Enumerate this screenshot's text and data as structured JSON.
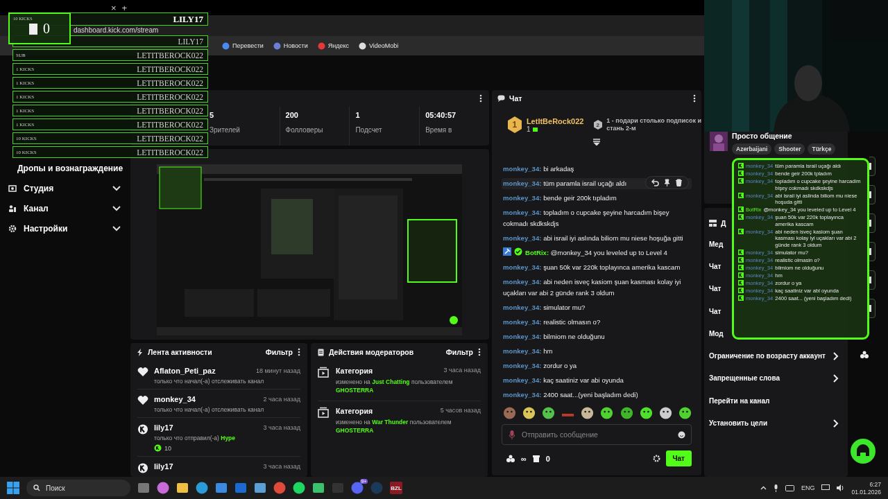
{
  "browser": {
    "tab_close": "×",
    "new_tab": "+",
    "address": "dashboard.kick.com/stream",
    "bookmarks": [
      "Перевести",
      "Новости",
      "Яндекс",
      "VideoMobi"
    ]
  },
  "sidebar": {
    "items": [
      {
        "label": "Дропы и вознаграждение",
        "kind": "subitem"
      },
      {
        "label": "Студия",
        "kind": "section"
      },
      {
        "label": "Канал",
        "kind": "section"
      },
      {
        "label": "Настройки",
        "kind": "section"
      }
    ]
  },
  "stats": [
    {
      "value": "5",
      "label": "Зрителей"
    },
    {
      "value": "200",
      "label": "Фолловеры"
    },
    {
      "value": "1",
      "label": "Подсчет"
    },
    {
      "value": "05:40:57",
      "label": "Время в"
    }
  ],
  "activity": {
    "title": "Лента активности",
    "filter": "Фильтр",
    "items": [
      {
        "kind": "follow",
        "user": "Aflaton_Peti_paz",
        "time": "18 минут назад",
        "text": "только что начал(-а) отслеживать канал"
      },
      {
        "kind": "follow",
        "user": "monkey_34",
        "time": "2 часа назад",
        "text": "только что начал(-а) отслеживать канал"
      },
      {
        "kind": "gift",
        "user": "lily17",
        "time": "3 часа назад",
        "text": "только что отправил(-а)",
        "highlight": "Hype",
        "amount": "10"
      },
      {
        "kind": "gift",
        "user": "lily17",
        "time": "3 часа назад"
      }
    ]
  },
  "mod_actions": {
    "title": "Действия модераторов",
    "filter": "Фильтр",
    "items": [
      {
        "title": "Категория",
        "time": "3 часа назад",
        "prefix": "изменено на",
        "target": "Just Chatting",
        "suffix": "пользователем",
        "user": "GHOSTERRA"
      },
      {
        "title": "Категория",
        "time": "5 часов назад",
        "prefix": "изменено на",
        "target": "War Thunder",
        "suffix": "пользователем",
        "user": "GHOSTERRA"
      }
    ]
  },
  "chat": {
    "title": "Чат",
    "leader": {
      "rank": "1",
      "user": "LetItBeRock022",
      "count": "1",
      "next_rank": "2",
      "next_text": "1 - подари столько подписок и стань 2-м"
    },
    "messages": [
      {
        "kind": "user",
        "user": "monkey_34:",
        "text": "bi arkadaş",
        "hovered": false
      },
      {
        "kind": "user",
        "user": "monkey_34:",
        "text": "tüm paramla israil uçağı aldı",
        "hovered": true
      },
      {
        "kind": "user",
        "user": "monkey_34:",
        "text": "bende geir 200k tıpladım",
        "hovered": false
      },
      {
        "kind": "user",
        "user": "monkey_34:",
        "text": "topladım o cupcake şeyine harcadım bişey cokmadı skdkskdjs",
        "hovered": false
      },
      {
        "kind": "user",
        "user": "monkey_34:",
        "text": "abi israil iyi aslında biliom mu niese hoşuğa gitti",
        "hovered": false
      },
      {
        "kind": "bot",
        "user": "BotRix:",
        "text": "@monkey_34 you leveled up to Level 4",
        "hovered": false
      },
      {
        "kind": "user",
        "user": "monkey_34:",
        "text": "şuan 50k var 220k toplayınca amerika kascam",
        "hovered": false
      },
      {
        "kind": "user",
        "user": "monkey_34:",
        "text": "abi neden isveç kasiom şuan kasması kolay iyi uçakları var abi 2 günde rank 3 oldum",
        "hovered": false
      },
      {
        "kind": "user",
        "user": "monkey_34:",
        "text": "simulator mu?",
        "hovered": false
      },
      {
        "kind": "user",
        "user": "monkey_34:",
        "text": "realistic olmasın o?",
        "hovered": false
      },
      {
        "kind": "user",
        "user": "monkey_34:",
        "text": "bilmiom ne olduğunu",
        "hovered": false
      },
      {
        "kind": "user",
        "user": "monkey_34:",
        "text": "hm",
        "hovered": false
      },
      {
        "kind": "user",
        "user": "monkey_34:",
        "text": "zordur o ya",
        "hovered": false
      },
      {
        "kind": "user",
        "user": "monkey_34:",
        "text": "kaç saatiniz var abi oyunda",
        "hovered": false
      },
      {
        "kind": "user",
        "user": "monkey_34:",
        "text": "2400 saat...(yeni başladım dedi)",
        "hovered": false
      }
    ],
    "input": {
      "placeholder": "Отправить сообщение"
    },
    "points": "∞",
    "store": "0",
    "send": "Чат"
  },
  "stream_info": {
    "title": "Просто общение",
    "tags": [
      "Azerbaijani",
      "Shooter",
      "Türkçe"
    ]
  },
  "channel_actions": {
    "title": "Д",
    "items": [
      {
        "label": "Мед",
        "arrow": false
      },
      {
        "label": "Чат",
        "arrow": false
      },
      {
        "label": "Чат",
        "arrow": false
      },
      {
        "label": "Чат",
        "arrow": false
      },
      {
        "label": "Мод",
        "arrow": false
      },
      {
        "label": "Ограничение по возрасту аккаунт",
        "arrow": true
      },
      {
        "label": "Запрещенные слова",
        "arrow": true
      },
      {
        "label": "Перейти на канал",
        "arrow": false
      },
      {
        "label": "Установить цели",
        "arrow": true
      }
    ]
  },
  "gift_overlay": {
    "box_label": "10 KICKS",
    "box_value": "0",
    "rows": [
      {
        "name": "LILY17",
        "top": true
      },
      {
        "name": "LILY17",
        "top": false
      },
      {
        "label": "SUB",
        "name": "LETITBEROCK022",
        "top": false
      },
      {
        "label": "1 KICKS",
        "name": "LETITBEROCK022",
        "top": false
      },
      {
        "label": "1 KICKS",
        "name": "LETITBEROCK022",
        "top": false
      },
      {
        "label": "1 KICKS",
        "name": "LETITBEROCK022",
        "top": false
      },
      {
        "label": "1 KICKS",
        "name": "LETITBEROCK022",
        "top": false
      },
      {
        "label": "1 KICKS",
        "name": "LETITBEROCK022",
        "top": false
      },
      {
        "label": "10 KICKS",
        "name": "LETITBEROCK022",
        "top": false
      },
      {
        "label": "10 KICKS",
        "name": "LETITBEROCK022",
        "top": false
      }
    ]
  },
  "chat_overlay": {
    "messages": [
      {
        "kind": "user",
        "user": "monkey_34",
        "text": "tüm paramla israil uçağı aldı"
      },
      {
        "kind": "user",
        "user": "monkey_34",
        "text": "bende geir 200k tpladım"
      },
      {
        "kind": "user",
        "user": "monkey_34",
        "text": "topladım o cupcake şeyine harcadim bişey cokmadı skdkskdjs"
      },
      {
        "kind": "user",
        "user": "monkey_34",
        "text": "abi israil iyi aslinda biliom mu niese hoşuda gitti"
      },
      {
        "kind": "bot",
        "user": "BotRix",
        "text": "@monkey_34 you leveled up to Level 4"
      },
      {
        "kind": "user",
        "user": "monkey_34",
        "text": "şuan 50k var 220k toplayınca amerika kascam"
      },
      {
        "kind": "user",
        "user": "monkey_34",
        "text": "abi neden isveç kasiom şuan kasması kolay iyi uçakları var abi 2 günde rank 3 oldum"
      },
      {
        "kind": "user",
        "user": "monkey_34",
        "text": "simulator mu?"
      },
      {
        "kind": "user",
        "user": "monkey_34",
        "text": "realistic olmasin o?"
      },
      {
        "kind": "user",
        "user": "monkey_34",
        "text": "bilmiom ne olduğunu"
      },
      {
        "kind": "user",
        "user": "monkey_34",
        "text": "hm"
      },
      {
        "kind": "user",
        "user": "monkey_34",
        "text": "zordur o ya"
      },
      {
        "kind": "user",
        "user": "monkey_34",
        "text": "kaç saatiniz var abi oyunda"
      },
      {
        "kind": "user",
        "user": "monkey_34",
        "text": "2400 saat... (yeni başladım dedi)"
      }
    ]
  },
  "taskbar": {
    "search": "Поиск",
    "apps": [
      {
        "kind": "taskview"
      },
      {
        "kind": "copilot"
      },
      {
        "kind": "folder"
      },
      {
        "kind": "edge"
      },
      {
        "kind": "store"
      },
      {
        "kind": "outlook"
      },
      {
        "kind": "photos"
      },
      {
        "kind": "chrome"
      },
      {
        "kind": "spotify"
      },
      {
        "kind": "greenapp"
      },
      {
        "kind": "darkapp"
      },
      {
        "kind": "discord",
        "badge": "9+"
      },
      {
        "kind": "steam"
      },
      {
        "kind": "label",
        "label": "BZL"
      }
    ],
    "language": "ENG",
    "time": "6:27",
    "date": "01.01.2026"
  }
}
